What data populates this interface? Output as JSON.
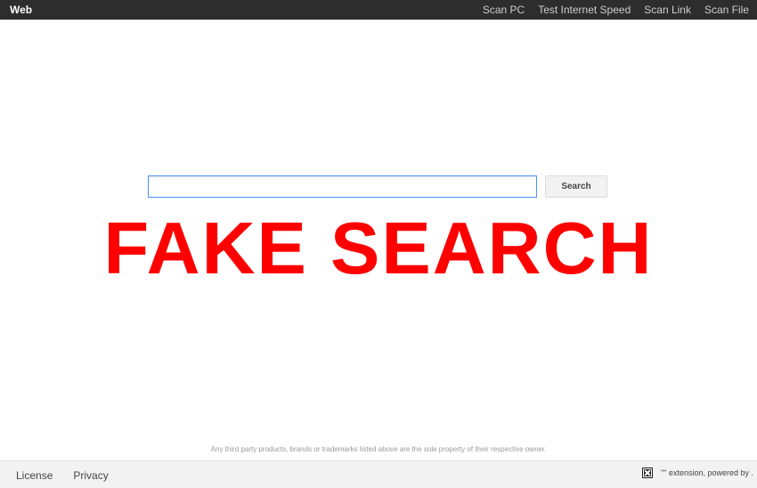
{
  "topbar": {
    "brand": "Web",
    "links": [
      "Scan PC",
      "Test Internet Speed",
      "Scan Link",
      "Scan File"
    ]
  },
  "search": {
    "value": "",
    "placeholder": "",
    "button_label": "Search"
  },
  "overlay_text": "FAKE SEARCH",
  "disclaimer": "Any third party products, brands or trademarks listed above are the sole property of their respective owner.",
  "footer": {
    "links": [
      "License",
      "Privacy"
    ],
    "powered_text": "\"\" extension, powered by ."
  },
  "colors": {
    "topbar_bg": "#2d2d2d",
    "overlay": "#ff0000",
    "input_border": "#4d90fe"
  }
}
